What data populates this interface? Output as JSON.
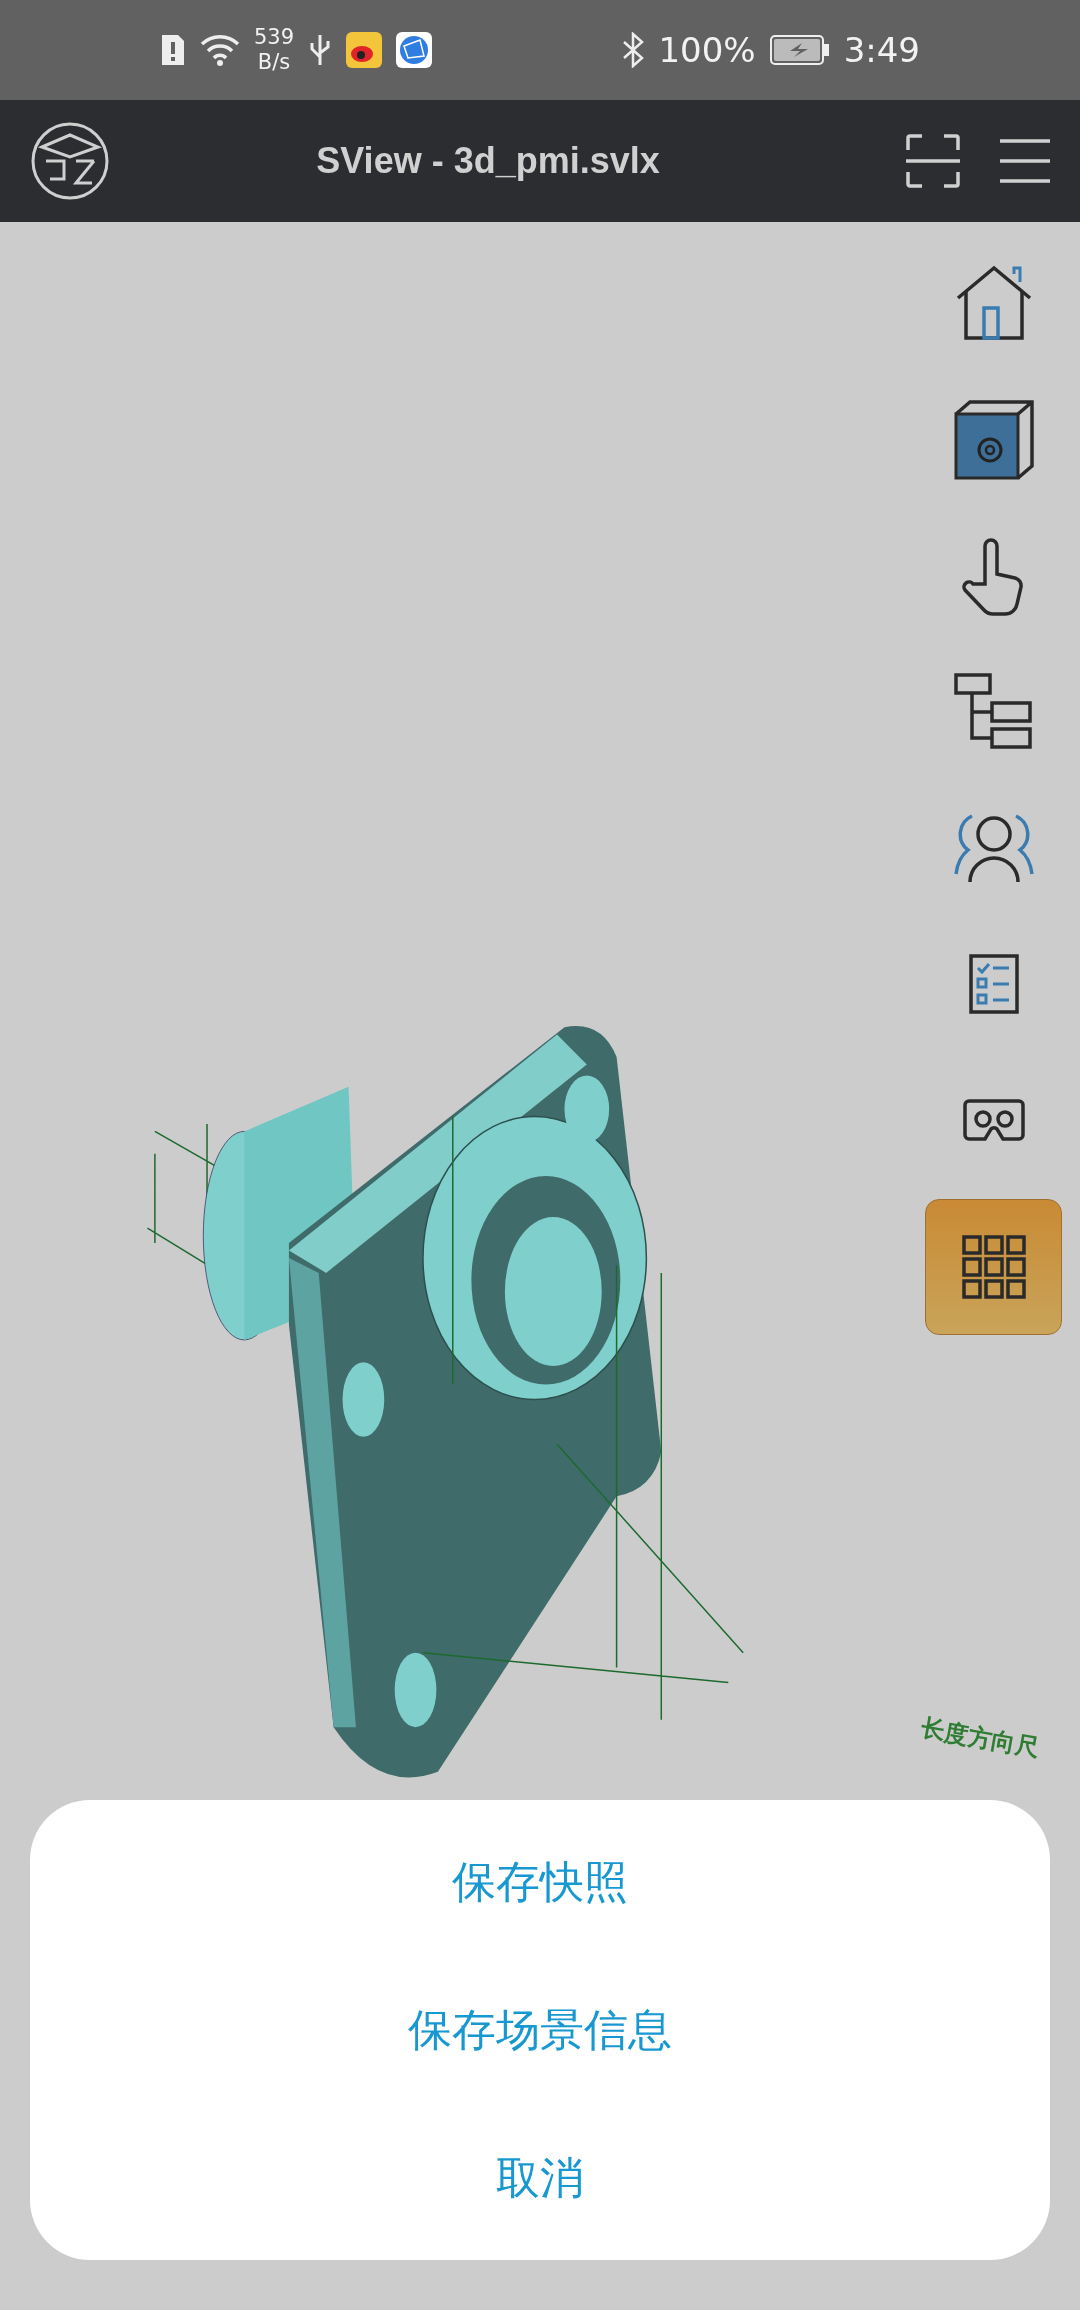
{
  "status_bar": {
    "net_speed_value": "539",
    "net_speed_unit": "B/s",
    "battery": "100%",
    "time": "3:49"
  },
  "app_bar": {
    "title": "SView - 3d_pmi.svlx"
  },
  "viewport": {
    "annotation": "长度方向尺"
  },
  "side_toolbar": [
    {
      "kind": "home"
    },
    {
      "kind": "box-settings"
    },
    {
      "kind": "hand"
    },
    {
      "kind": "tree"
    },
    {
      "kind": "users"
    },
    {
      "kind": "checklist"
    },
    {
      "kind": "vr"
    },
    {
      "kind": "grid"
    }
  ],
  "action_sheet": [
    {
      "label": "保存快照"
    },
    {
      "label": "保存场景信息"
    },
    {
      "label": "取消"
    }
  ]
}
